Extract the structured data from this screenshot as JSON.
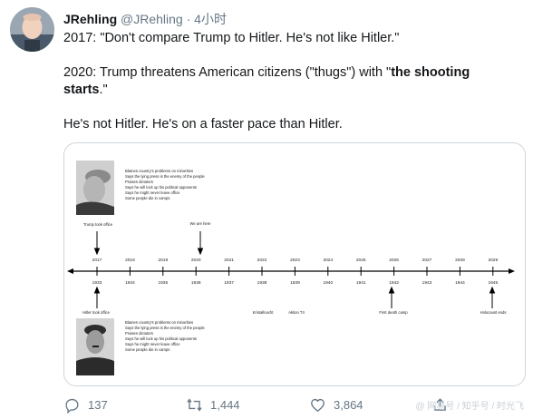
{
  "author": {
    "display_name": "JRehling",
    "handle": "@JRehling",
    "separator": "·",
    "time": "4小时"
  },
  "tweet": {
    "line1": "2017: \"Don't compare Trump to Hitler. He's not like Hitler.\"",
    "line2_prefix": "2020: Trump threatens American citizens (\"thugs\") with \"",
    "line2_bold_a": "the shooting",
    "line3_bold_b": "starts",
    "line3_suffix": ".\"",
    "line4": "He's not Hitler. He's on a faster pace than Hitler."
  },
  "timeline": {
    "top_years": [
      "2017",
      "2018",
      "2019",
      "2020",
      "2021",
      "2022",
      "2023",
      "2024",
      "2025",
      "2026",
      "2027",
      "2028",
      "2029"
    ],
    "bottom_years": [
      "1933",
      "1934",
      "1935",
      "1936",
      "1937",
      "1938",
      "1939",
      "1940",
      "1941",
      "1942",
      "1943",
      "1944",
      "1945"
    ],
    "top_list": [
      "Blames country's problems on minorities",
      "Says the lying press is the enemy of the people",
      "Praises dictators",
      "Says he will lock up his political opponents",
      "Says he might never leave office",
      "Some people die in camps"
    ],
    "bottom_list": [
      "Blames country's problems on minorities",
      "Says the lying press is the enemy of the people",
      "Praises dictators",
      "Says he will lock up his political opponents",
      "Says he might never leave office",
      "Some people die in camps"
    ],
    "label_trump_took_office": "Trump took office",
    "label_we_are_here": "We are here",
    "label_hitler_took_office": "Hitler took office",
    "label_kristallnacht": "Kristallnacht",
    "label_aktion": "Aktion T4",
    "label_first_death_camp": "First death camp",
    "label_holocaust_ends": "Holocaust ends"
  },
  "actions": {
    "reply_count": "137",
    "retweet_count": "1,444",
    "like_count": "3,864"
  },
  "watermark": "@ 网易号 / 知乎号 / 时光飞",
  "colors": {
    "text": "#14171a",
    "muted": "#657786",
    "border": "#ccd6dd"
  }
}
